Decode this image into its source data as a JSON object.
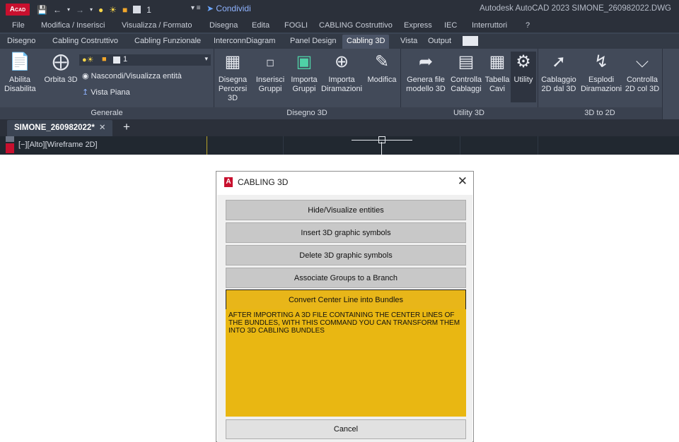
{
  "app": {
    "logo": "A",
    "logo_sub": "CAD",
    "qat_layer": "1",
    "share_label": "Condividi",
    "title": "Autodesk AutoCAD 2023   SIMONE_260982022.DWG"
  },
  "menu": [
    "File",
    "Modifica / Inserisci",
    "Visualizza / Formato",
    "Disegna",
    "Edita",
    "FOGLI",
    "CABLING Costruttivo",
    "Express",
    "IEC",
    "Interruttori",
    "?"
  ],
  "tabs": [
    "Disegno",
    "Cabling Costruttivo",
    "Cabling Funzionale",
    "InterconnDiagram",
    "Panel Design",
    "Cabling 3D",
    "Vista",
    "Output"
  ],
  "active_tab": "Cabling 3D",
  "ribbon": {
    "generale": {
      "title": "Generale",
      "abilita": "Abilita\nDisabilita",
      "abilita_l1": "Abilita",
      "abilita_l2": "Disabilita",
      "orbita": "Orbita 3D",
      "layer_value": "1",
      "nascondi": "Nascondi/Visualizza entità",
      "vista_piana": "Vista Piana"
    },
    "disegno3d": {
      "title": "Disegno 3D",
      "b1_l1": "Disegna",
      "b1_l2": "Percorsi 3D",
      "b2_l1": "Inserisci",
      "b2_l2": "Gruppi",
      "b3_l1": "Importa",
      "b3_l2": "Gruppi",
      "b4_l1": "Importa",
      "b4_l2": "Diramazioni",
      "b5_l1": "Modifica",
      "b5_l2": ""
    },
    "utility3d": {
      "title": "Utility 3D",
      "b1_l1": "Genera file",
      "b1_l2": "modello 3D",
      "b2_l1": "Controlla",
      "b2_l2": "Cablaggi",
      "b3_l1": "Tabella",
      "b3_l2": "Cavi",
      "b4_l1": "Utility",
      "b4_l2": ""
    },
    "to2d": {
      "title": "3D to 2D",
      "b1_l1": "Cablaggio",
      "b1_l2": "2D dal 3D",
      "b2_l1": "Esplodi",
      "b2_l2": "Diramazioni",
      "b3_l1": "Controlla",
      "b3_l2": "2D col 3D"
    }
  },
  "doc_tab": "SIMONE_260982022*",
  "viewport_label": "[−][Alto][Wireframe 2D]",
  "dialog": {
    "title": "CABLING 3D",
    "buttons": [
      "Hide/Visualize entities",
      "Insert 3D graphic symbols",
      "Delete 3D graphic symbols",
      "Associate Groups to a Branch",
      "Convert Center Line into Bundles"
    ],
    "highlighted_index": 4,
    "description": "AFTER IMPORTING A 3D FILE CONTAINING THE CENTER LINES OF THE BUNDLES, WITH THIS COMMAND YOU CAN TRANSFORM THEM INTO 3D CABLING BUNDLES",
    "cancel": "Cancel"
  },
  "colors": {
    "highlight": "#e9b712",
    "dialog_button": "#c8c8c8",
    "app_bg": "#3b4453",
    "brand_red": "#c8102e"
  }
}
